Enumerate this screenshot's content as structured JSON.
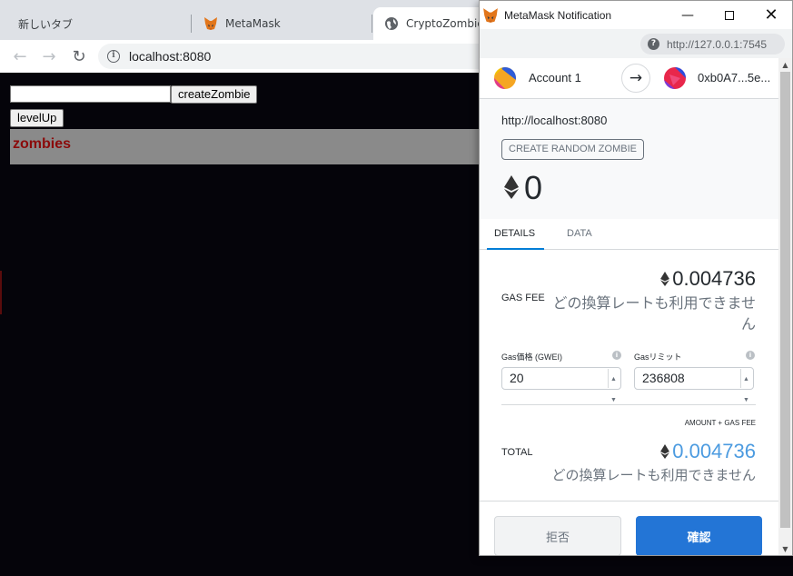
{
  "browser": {
    "tabs": [
      {
        "title": "新しいタブ",
        "icon": "none"
      },
      {
        "title": "MetaMask",
        "icon": "metamask-fox-icon"
      },
      {
        "title": "CryptoZombies",
        "icon": "globe-icon"
      }
    ],
    "address": "localhost:8080"
  },
  "page": {
    "create_button": "createZombie",
    "levelup_button": "levelUp",
    "zombies_heading": "zombies",
    "input_value": ""
  },
  "metamask": {
    "window_title": "MetaMask Notification",
    "popup_url": "http://127.0.0.1:7545",
    "from_account": "Account 1",
    "to_account": "0xb0A7...5e...",
    "origin": "http://localhost:8080",
    "method": "CREATE RANDOM ZOMBIE",
    "value": "0",
    "tabs": {
      "details": "DETAILS",
      "data": "DATA"
    },
    "gas_fee_label": "GAS FEE",
    "gas_fee_eth": "0.004736",
    "gas_fee_fiat": "どの換算レートも利用できません",
    "gas_price_label": "Gas価格 (GWEI)",
    "gas_price_value": "20",
    "gas_limit_label": "Gasリミット",
    "gas_limit_value": "236808",
    "total_caption": "AMOUNT + GAS FEE",
    "total_label": "TOTAL",
    "total_eth": "0.004736",
    "total_fiat": "どの換算レートも利用できません",
    "reject_button": "拒否",
    "confirm_button": "確認"
  },
  "colors": {
    "accent": "#2375d6",
    "total_value": "#4c9be0",
    "page_background": "#05040a",
    "zombie_heading": "#8b0a0a"
  }
}
